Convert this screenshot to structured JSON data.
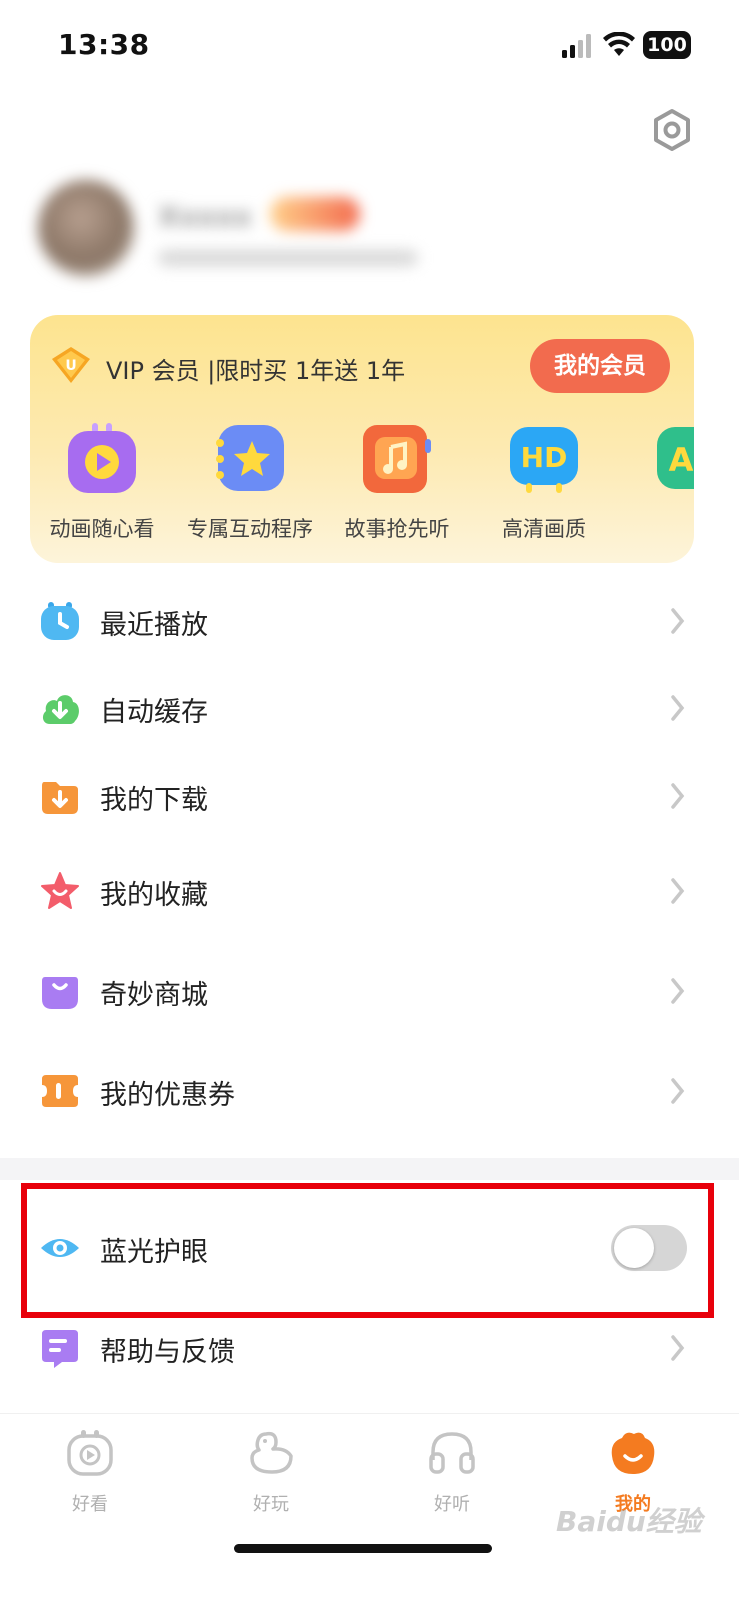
{
  "status_bar": {
    "time": "13:38",
    "battery": "100"
  },
  "profile": {
    "username": "Xxxxx"
  },
  "vip": {
    "title": "VIP 会员 |限时买 1年送 1年",
    "button": "我的会员",
    "perks": [
      {
        "label": "动画随心看",
        "icon": "play-icon"
      },
      {
        "label": "专属互动程序",
        "icon": "star-icon"
      },
      {
        "label": "故事抢先听",
        "icon": "music-icon"
      },
      {
        "label": "高清画质",
        "icon": "hd-icon"
      },
      {
        "label": "",
        "icon": "a-icon"
      }
    ]
  },
  "menu": [
    {
      "label": "最近播放",
      "icon": "clock-icon"
    },
    {
      "label": "自动缓存",
      "icon": "cloud-download-icon"
    },
    {
      "label": "我的下载",
      "icon": "download-icon"
    },
    {
      "label": "我的收藏",
      "icon": "star-icon"
    },
    {
      "label": "奇妙商城",
      "icon": "shopping-bag-icon"
    },
    {
      "label": "我的优惠券",
      "icon": "coupon-icon"
    }
  ],
  "settings_items": [
    {
      "label": "蓝光护眼",
      "icon": "eye-icon",
      "toggle": false
    },
    {
      "label": "帮助与反馈",
      "icon": "feedback-icon"
    }
  ],
  "tabs": [
    {
      "label": "好看",
      "icon": "tv-icon",
      "active": false
    },
    {
      "label": "好玩",
      "icon": "duck-icon",
      "active": false
    },
    {
      "label": "好听",
      "icon": "headphones-icon",
      "active": false
    },
    {
      "label": "我的",
      "icon": "face-icon",
      "active": true
    }
  ],
  "colors": {
    "accent": "#f47b20",
    "vip_button": "#f26b4e",
    "highlight": "#e8000b"
  },
  "watermark": "Baidu经验"
}
